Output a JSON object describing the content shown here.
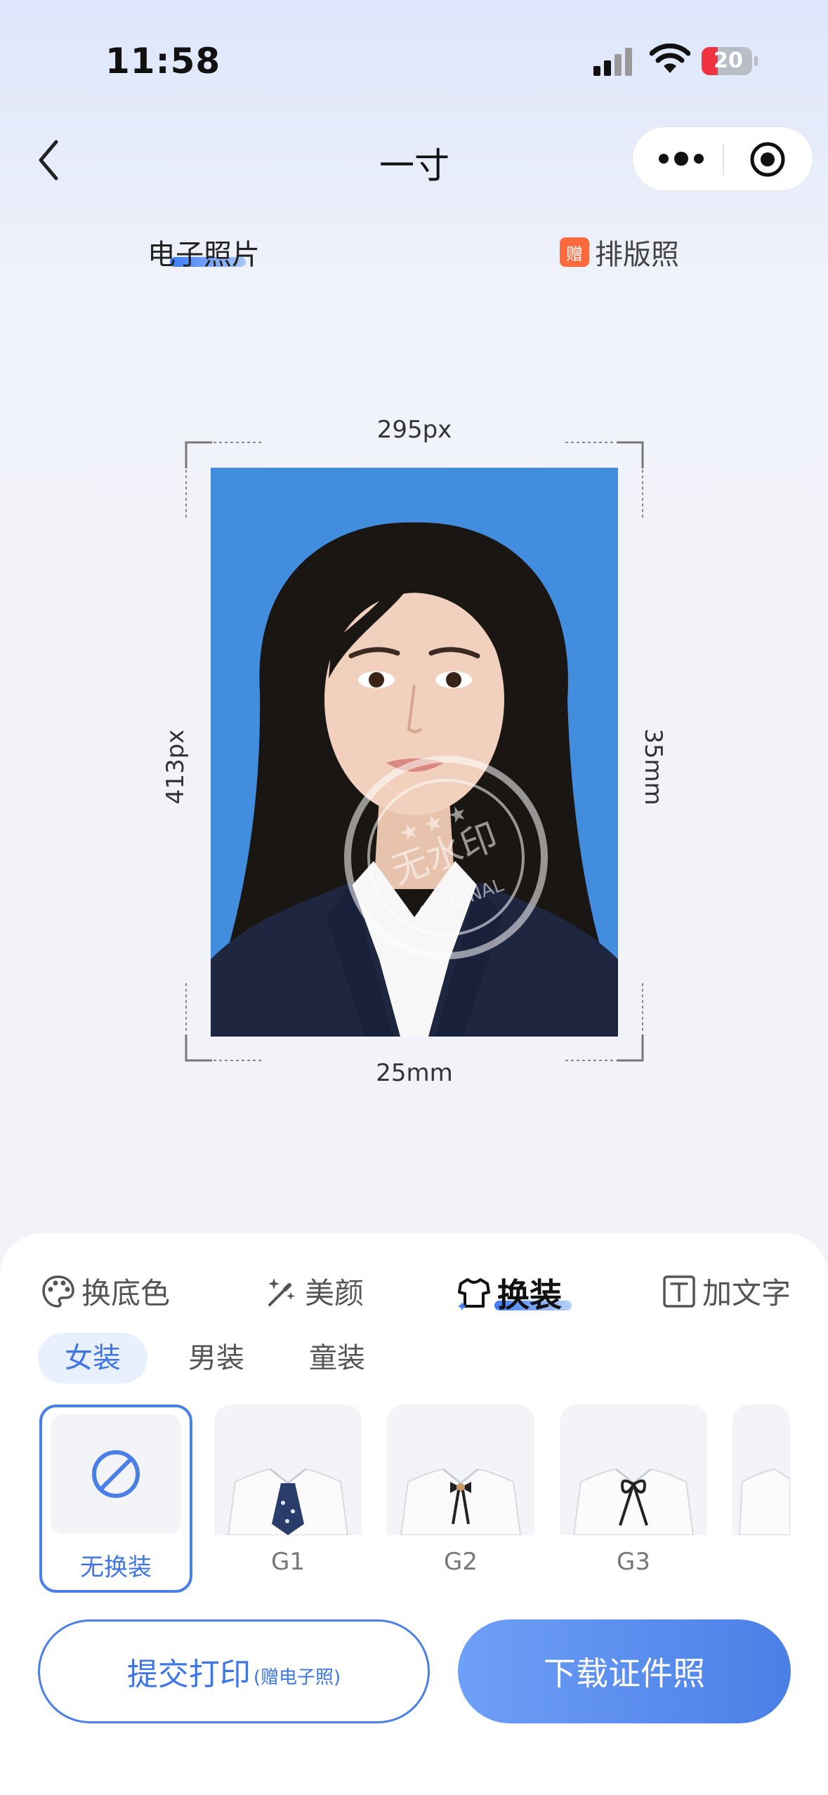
{
  "status_bar": {
    "time": "11:58",
    "battery": "20",
    "icons": [
      "signal-icon",
      "wifi-icon",
      "battery-icon"
    ]
  },
  "nav": {
    "title": "一寸",
    "icons": [
      "back-icon",
      "more-icon",
      "target-icon"
    ]
  },
  "top_tabs": {
    "electronic": "电子照片",
    "layout": "排版照",
    "layout_badge": "赠"
  },
  "photo": {
    "width_px": "295px",
    "height_px": "413px",
    "width_mm": "25mm",
    "height_mm": "35mm",
    "background_color": "#438dde",
    "watermark_text": "无水印",
    "watermark_sub": "ORIGINAL"
  },
  "tools": {
    "change_bg": "换底色",
    "beauty": "美颜",
    "outfit": "换装",
    "add_text": "加文字",
    "selected": "换装"
  },
  "outfit_categories": {
    "female": "女装",
    "male": "男装",
    "child": "童装",
    "selected": "女装"
  },
  "outfits": {
    "none": "无换装",
    "g1": "G1",
    "g2": "G2",
    "g3": "G3"
  },
  "buttons": {
    "print": "提交打印",
    "print_note": "(赠电子照)",
    "download": "下载证件照"
  },
  "colors": {
    "accent": "#4a7fe6",
    "badge": "#ff6a3d",
    "photo_bg": "#438dde"
  }
}
